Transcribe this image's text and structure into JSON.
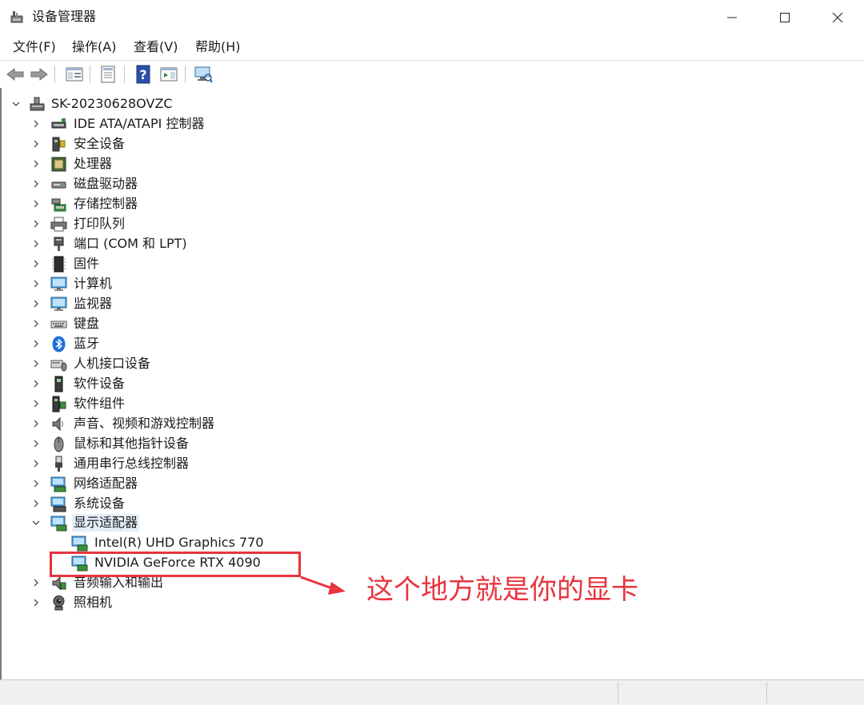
{
  "window": {
    "title": "设备管理器"
  },
  "menu": [
    {
      "label": "文件(F)"
    },
    {
      "label": "操作(A)"
    },
    {
      "label": "查看(V)"
    },
    {
      "label": "帮助(H)"
    }
  ],
  "tree": {
    "root": {
      "label": "SK-20230628OVZC",
      "icon": "computer-icon"
    },
    "categories": [
      {
        "label": "IDE ATA/ATAPI 控制器",
        "icon": "ide-controller-icon"
      },
      {
        "label": "安全设备",
        "icon": "security-device-icon"
      },
      {
        "label": "处理器",
        "icon": "processor-icon"
      },
      {
        "label": "磁盘驱动器",
        "icon": "disk-drive-icon"
      },
      {
        "label": "存储控制器",
        "icon": "storage-controller-icon"
      },
      {
        "label": "打印队列",
        "icon": "printer-icon"
      },
      {
        "label": "端口 (COM 和 LPT)",
        "icon": "port-icon"
      },
      {
        "label": "固件",
        "icon": "firmware-icon"
      },
      {
        "label": "计算机",
        "icon": "computer-monitor-icon"
      },
      {
        "label": "监视器",
        "icon": "monitor-icon"
      },
      {
        "label": "键盘",
        "icon": "keyboard-icon"
      },
      {
        "label": "蓝牙",
        "icon": "bluetooth-icon"
      },
      {
        "label": "人机接口设备",
        "icon": "hid-icon"
      },
      {
        "label": "软件设备",
        "icon": "software-device-icon"
      },
      {
        "label": "软件组件",
        "icon": "software-component-icon"
      },
      {
        "label": "声音、视频和游戏控制器",
        "icon": "speaker-icon"
      },
      {
        "label": "鼠标和其他指针设备",
        "icon": "mouse-icon"
      },
      {
        "label": "通用串行总线控制器",
        "icon": "usb-icon"
      },
      {
        "label": "网络适配器",
        "icon": "network-adapter-icon"
      },
      {
        "label": "系统设备",
        "icon": "system-device-icon"
      },
      {
        "label": "显示适配器",
        "icon": "display-adapter-icon",
        "expanded": true,
        "selected": true
      },
      {
        "label": "Intel(R) UHD Graphics 770",
        "icon": "display-adapter-icon",
        "child": true
      },
      {
        "label": "NVIDIA GeForce RTX 4090",
        "icon": "display-adapter-icon",
        "child": true
      },
      {
        "label": "音频输入和输出",
        "icon": "audio-io-icon"
      },
      {
        "label": "照相机",
        "icon": "camera-icon"
      }
    ]
  },
  "annotation": {
    "text": "这个地方就是你的显卡",
    "color": "#e8343e"
  },
  "colors": {
    "selection": "#e3eef9",
    "annotation": "#e8343e"
  }
}
